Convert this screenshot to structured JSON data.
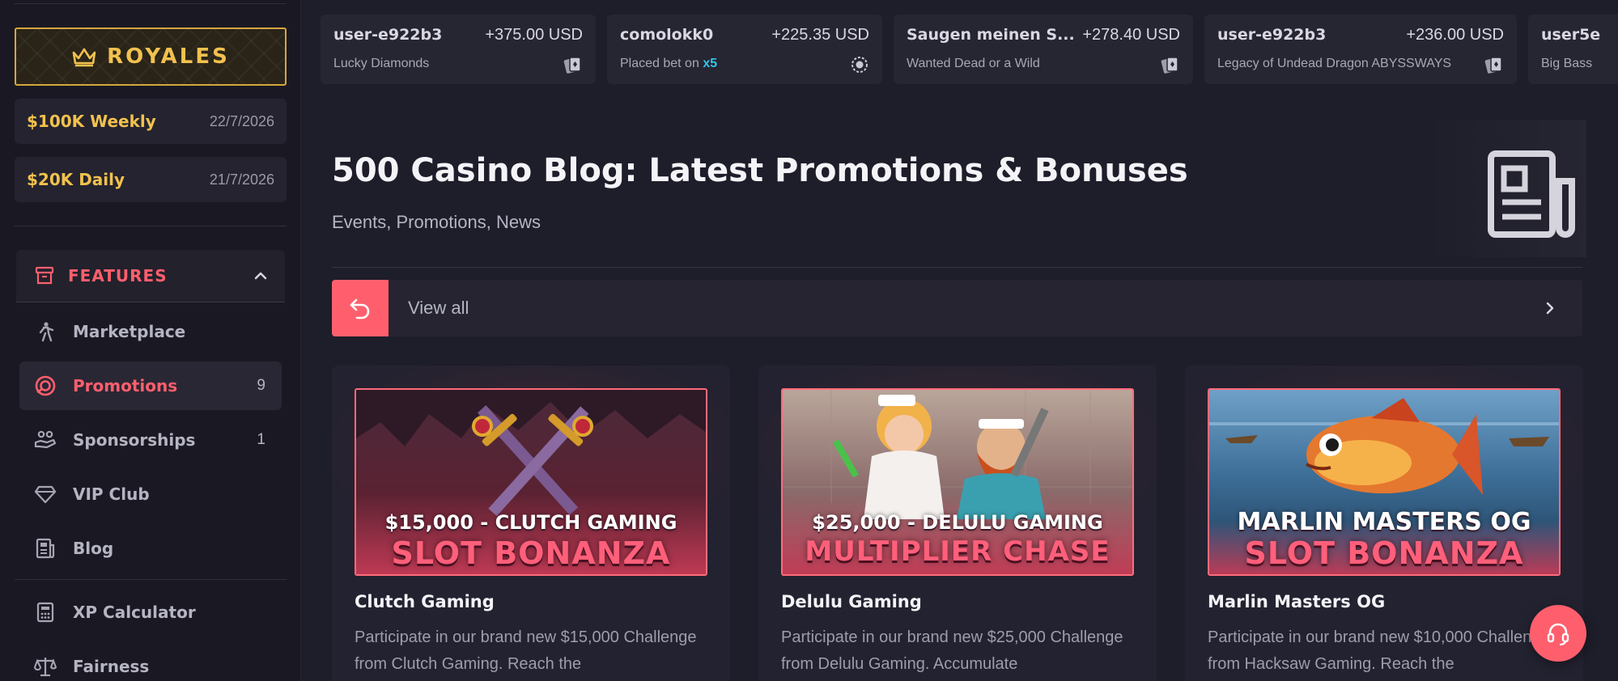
{
  "sidebar": {
    "brand": {
      "label": "ROYALES"
    },
    "races": [
      {
        "name": "$100K Weekly",
        "date": "22/7/2026"
      },
      {
        "name": "$20K Daily",
        "date": "21/7/2026"
      }
    ],
    "features_title": "FEATURES",
    "nav": [
      {
        "label": "Marketplace",
        "icon": "soldier-icon"
      },
      {
        "label": "Promotions",
        "icon": "promotions-icon",
        "count": "9",
        "active": true
      },
      {
        "label": "Sponsorships",
        "icon": "handshake-icon",
        "count": "1"
      },
      {
        "label": "VIP Club",
        "icon": "diamond-icon"
      },
      {
        "label": "Blog",
        "icon": "newspaper-icon"
      },
      {
        "label": "XP Calculator",
        "icon": "calculator-icon"
      },
      {
        "label": "Fairness",
        "icon": "scale-icon"
      }
    ]
  },
  "ticker": [
    {
      "user": "user-e922b3",
      "amount": "+375.00",
      "currency": "USD",
      "game": "Lucky Diamonds",
      "icon": "cards-icon"
    },
    {
      "user": "comolokk0",
      "amount": "+225.35",
      "currency": "USD",
      "game_prefix": "Placed bet on",
      "multiplier": "x5",
      "icon": "wheel-icon"
    },
    {
      "user": "Saugen meinen S...",
      "amount": "+278.40",
      "currency": "USD",
      "game": "Wanted Dead or a Wild",
      "icon": "cards-icon"
    },
    {
      "user": "user-e922b3",
      "amount": "+236.00",
      "currency": "USD",
      "game": "Legacy of Undead Dragon ABYSSWAYS",
      "icon": "cards-icon"
    },
    {
      "user": "user5e",
      "game": "Big Bass"
    }
  ],
  "header": {
    "title": "500 Casino Blog: Latest Promotions & Bonuses",
    "subtitle": "Events, Promotions, News"
  },
  "viewall": {
    "label": "View all"
  },
  "cards": [
    {
      "banner_line1": "$15,000 - CLUTCH GAMING",
      "banner_line2": "SLOT BONANZA",
      "title": "Clutch Gaming",
      "desc": "Participate in our brand new $15,000 Challenge from Clutch Gaming. Reach the"
    },
    {
      "banner_line1": "$25,000 - DELULU GAMING",
      "banner_line2": "MULTIPLIER CHASE",
      "title": "Delulu Gaming",
      "desc": "Participate in our brand new $25,000 Challenge from Delulu Gaming. Accumulate"
    },
    {
      "banner_line1": "MARLIN MASTERS OG",
      "banner_line2": "SLOT BONANZA",
      "title": "Marlin Masters OG",
      "desc": "Participate in our brand new $10,000 Challenge from Hacksaw Gaming. Reach the"
    }
  ],
  "colors": {
    "accent": "#ff5f6d",
    "gold": "#f2c14e",
    "multiplier": "#35c3e8",
    "background": "#1e1d2a"
  }
}
